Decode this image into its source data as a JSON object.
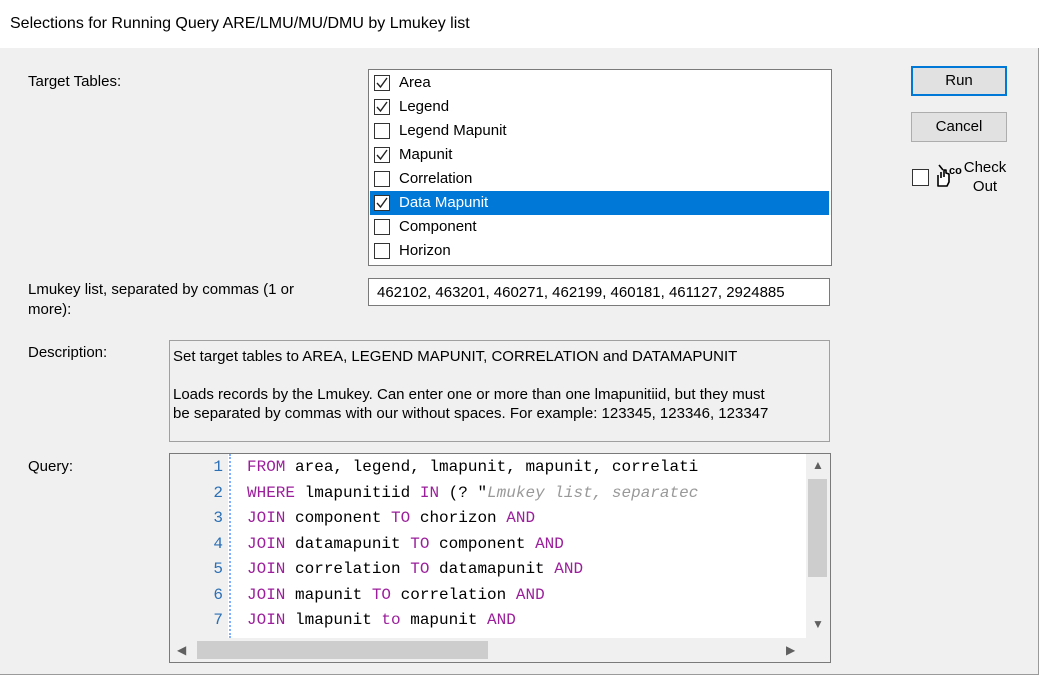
{
  "window": {
    "title": "Selections for Running Query ARE/LMU/MU/DMU by Lmukey list"
  },
  "labels": {
    "target_tables": "Target Tables:",
    "lmukey_list_line1": "Lmukey list, separated by commas (1 or",
    "lmukey_list_line2": "more):",
    "description": "Description:",
    "query": "Query:"
  },
  "target_tables": [
    {
      "label": "Area",
      "checked": true,
      "selected": false
    },
    {
      "label": "Legend",
      "checked": true,
      "selected": false
    },
    {
      "label": "Legend Mapunit",
      "checked": false,
      "selected": false
    },
    {
      "label": "Mapunit",
      "checked": true,
      "selected": false
    },
    {
      "label": "Correlation",
      "checked": false,
      "selected": false
    },
    {
      "label": "Data Mapunit",
      "checked": true,
      "selected": true
    },
    {
      "label": "Component",
      "checked": false,
      "selected": false
    },
    {
      "label": "Horizon",
      "checked": false,
      "selected": false
    }
  ],
  "lmukey_list": {
    "value": "462102, 463201, 460271, 462199, 460181, 461127, 2924885"
  },
  "description": {
    "line1": "Set target tables to AREA, LEGEND MAPUNIT, CORRELATION and DATAMAPUNIT",
    "line2": "",
    "line3": "Loads records by the Lmukey.  Can enter one or more than one lmapunitiid, but they must",
    "line4": "be separated by commas with our without spaces.  For example: 123345, 123346, 123347"
  },
  "query": {
    "lines": [
      {
        "num": "1",
        "tokens": [
          {
            "t": "FROM",
            "c": "kw"
          },
          {
            "t": " area, legend, lmapunit, mapunit, correlati",
            "c": "id"
          }
        ]
      },
      {
        "num": "2",
        "tokens": [
          {
            "t": "WHERE",
            "c": "kw"
          },
          {
            "t": " lmapunitiid ",
            "c": "id"
          },
          {
            "t": "IN",
            "c": "kw"
          },
          {
            "t": " (? \"",
            "c": "id"
          },
          {
            "t": "Lmukey list, separatec",
            "c": "cm"
          }
        ]
      },
      {
        "num": "3",
        "tokens": [
          {
            "t": "JOIN",
            "c": "kw"
          },
          {
            "t": " component ",
            "c": "id"
          },
          {
            "t": "TO",
            "c": "kw"
          },
          {
            "t": " chorizon ",
            "c": "id"
          },
          {
            "t": "AND",
            "c": "kw"
          }
        ]
      },
      {
        "num": "4",
        "tokens": [
          {
            "t": "JOIN",
            "c": "kw"
          },
          {
            "t": " datamapunit ",
            "c": "id"
          },
          {
            "t": "TO",
            "c": "kw"
          },
          {
            "t": " component ",
            "c": "id"
          },
          {
            "t": "AND",
            "c": "kw"
          }
        ]
      },
      {
        "num": "5",
        "tokens": [
          {
            "t": "JOIN",
            "c": "kw"
          },
          {
            "t": " correlation ",
            "c": "id"
          },
          {
            "t": "TO",
            "c": "kw"
          },
          {
            "t": " datamapunit ",
            "c": "id"
          },
          {
            "t": "AND",
            "c": "kw"
          }
        ]
      },
      {
        "num": "6",
        "tokens": [
          {
            "t": "JOIN",
            "c": "kw"
          },
          {
            "t": " mapunit ",
            "c": "id"
          },
          {
            "t": "TO",
            "c": "kw"
          },
          {
            "t": " correlation ",
            "c": "id"
          },
          {
            "t": "AND",
            "c": "kw"
          }
        ]
      },
      {
        "num": "7",
        "tokens": [
          {
            "t": "JOIN",
            "c": "kw"
          },
          {
            "t": " lmapunit ",
            "c": "id"
          },
          {
            "t": "to",
            "c": "kw"
          },
          {
            "t": " mapunit ",
            "c": "id"
          },
          {
            "t": "AND",
            "c": "kw"
          }
        ]
      }
    ]
  },
  "buttons": {
    "run": "Run",
    "cancel": "Cancel"
  },
  "checkout": {
    "line1": "Check",
    "line2": "Out",
    "icon_badge": "co",
    "checked": false,
    "icon": "checkout-hand-icon"
  },
  "colors": {
    "selection": "#0078d7",
    "keyword": "#9b1f9b",
    "line_number": "#2b6fb5"
  }
}
